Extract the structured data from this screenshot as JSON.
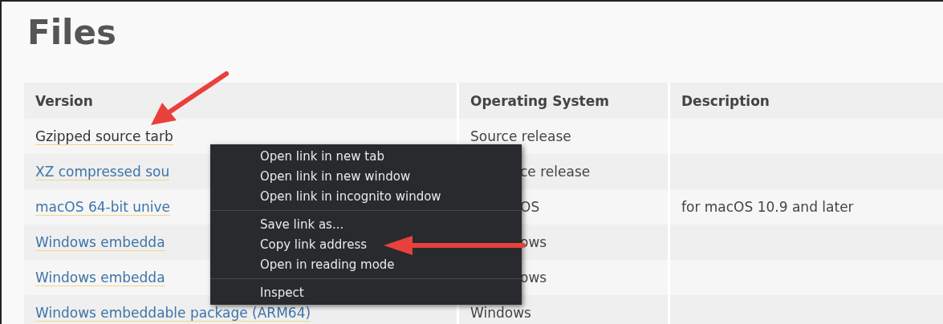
{
  "title": "Files",
  "table": {
    "columns": [
      "Version",
      "Operating System",
      "Description"
    ],
    "rows": [
      {
        "kind": "plain",
        "cells": [
          "Gzipped source tarb",
          "Source release",
          ""
        ]
      },
      {
        "kind": "link",
        "cells": [
          "XZ compressed sou",
          "ce release",
          ""
        ],
        "os_covered": true
      },
      {
        "kind": "link",
        "cells": [
          "macOS 64-bit unive",
          "OS",
          "for macOS 10.9 and later"
        ],
        "os_covered": true
      },
      {
        "kind": "link",
        "cells": [
          "Windows embedda",
          "ows",
          ""
        ],
        "os_covered": true
      },
      {
        "kind": "link",
        "cells": [
          "Windows embedda",
          "ows",
          ""
        ],
        "os_covered": true
      },
      {
        "kind": "link",
        "cells": [
          "Windows embeddable package (ARM64)",
          "Windows",
          ""
        ]
      }
    ]
  },
  "context_menu": {
    "groups": [
      [
        "Open link in new tab",
        "Open link in new window",
        "Open link in incognito window"
      ],
      [
        "Save link as...",
        "Copy link address",
        "Open in reading mode"
      ],
      [
        "Inspect"
      ]
    ]
  }
}
